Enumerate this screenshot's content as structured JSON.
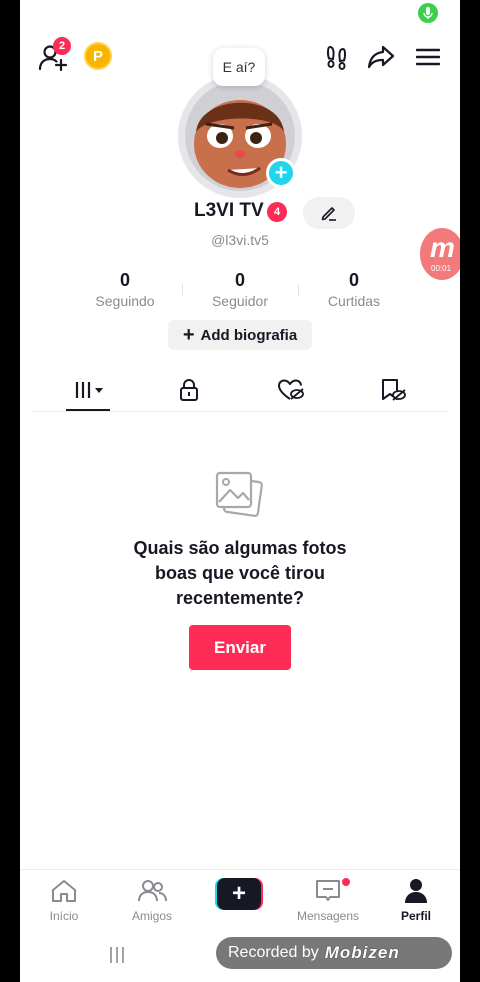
{
  "header": {
    "friend_requests_count": "2",
    "coin_label": "P",
    "bubble_text": "E aí?"
  },
  "profile": {
    "name": "L3VI TV",
    "name_badge": "4",
    "handle": "@l3vi.tv5",
    "stats": [
      {
        "value": "0",
        "label": "Seguindo"
      },
      {
        "value": "0",
        "label": "Seguidor"
      },
      {
        "value": "0",
        "label": "Curtidas"
      }
    ],
    "bio_button": "Add biografia"
  },
  "tabs": [
    {
      "name": "posts",
      "icon": "grid-icon",
      "active": true
    },
    {
      "name": "private",
      "icon": "lock-icon"
    },
    {
      "name": "liked",
      "icon": "hidden-heart-icon"
    },
    {
      "name": "saved",
      "icon": "hidden-bookmark-icon"
    }
  ],
  "empty_state": {
    "icon": "photos-icon",
    "title_line1": "Quais são algumas fotos",
    "title_line2": "boas que você tirou",
    "title_line3": "recentemente?",
    "button": "Enviar"
  },
  "recording_widget": {
    "letter": "m",
    "timer": "00:01"
  },
  "bottom_nav": [
    {
      "label": "Início",
      "icon": "home-icon"
    },
    {
      "label": "Amigos",
      "icon": "friends-icon"
    },
    {
      "label": "",
      "icon": "plus-icon"
    },
    {
      "label": "Mensagens",
      "icon": "inbox-icon"
    },
    {
      "label": "Perfil",
      "icon": "person-icon",
      "active": true
    }
  ],
  "overlay": {
    "recorded_by": "Recorded by",
    "brand": "Mobizen"
  },
  "colors": {
    "accent": "#fe2c55",
    "cyan": "#20d5ec",
    "coin": "#f7b500",
    "mic": "#3ccf4e"
  }
}
